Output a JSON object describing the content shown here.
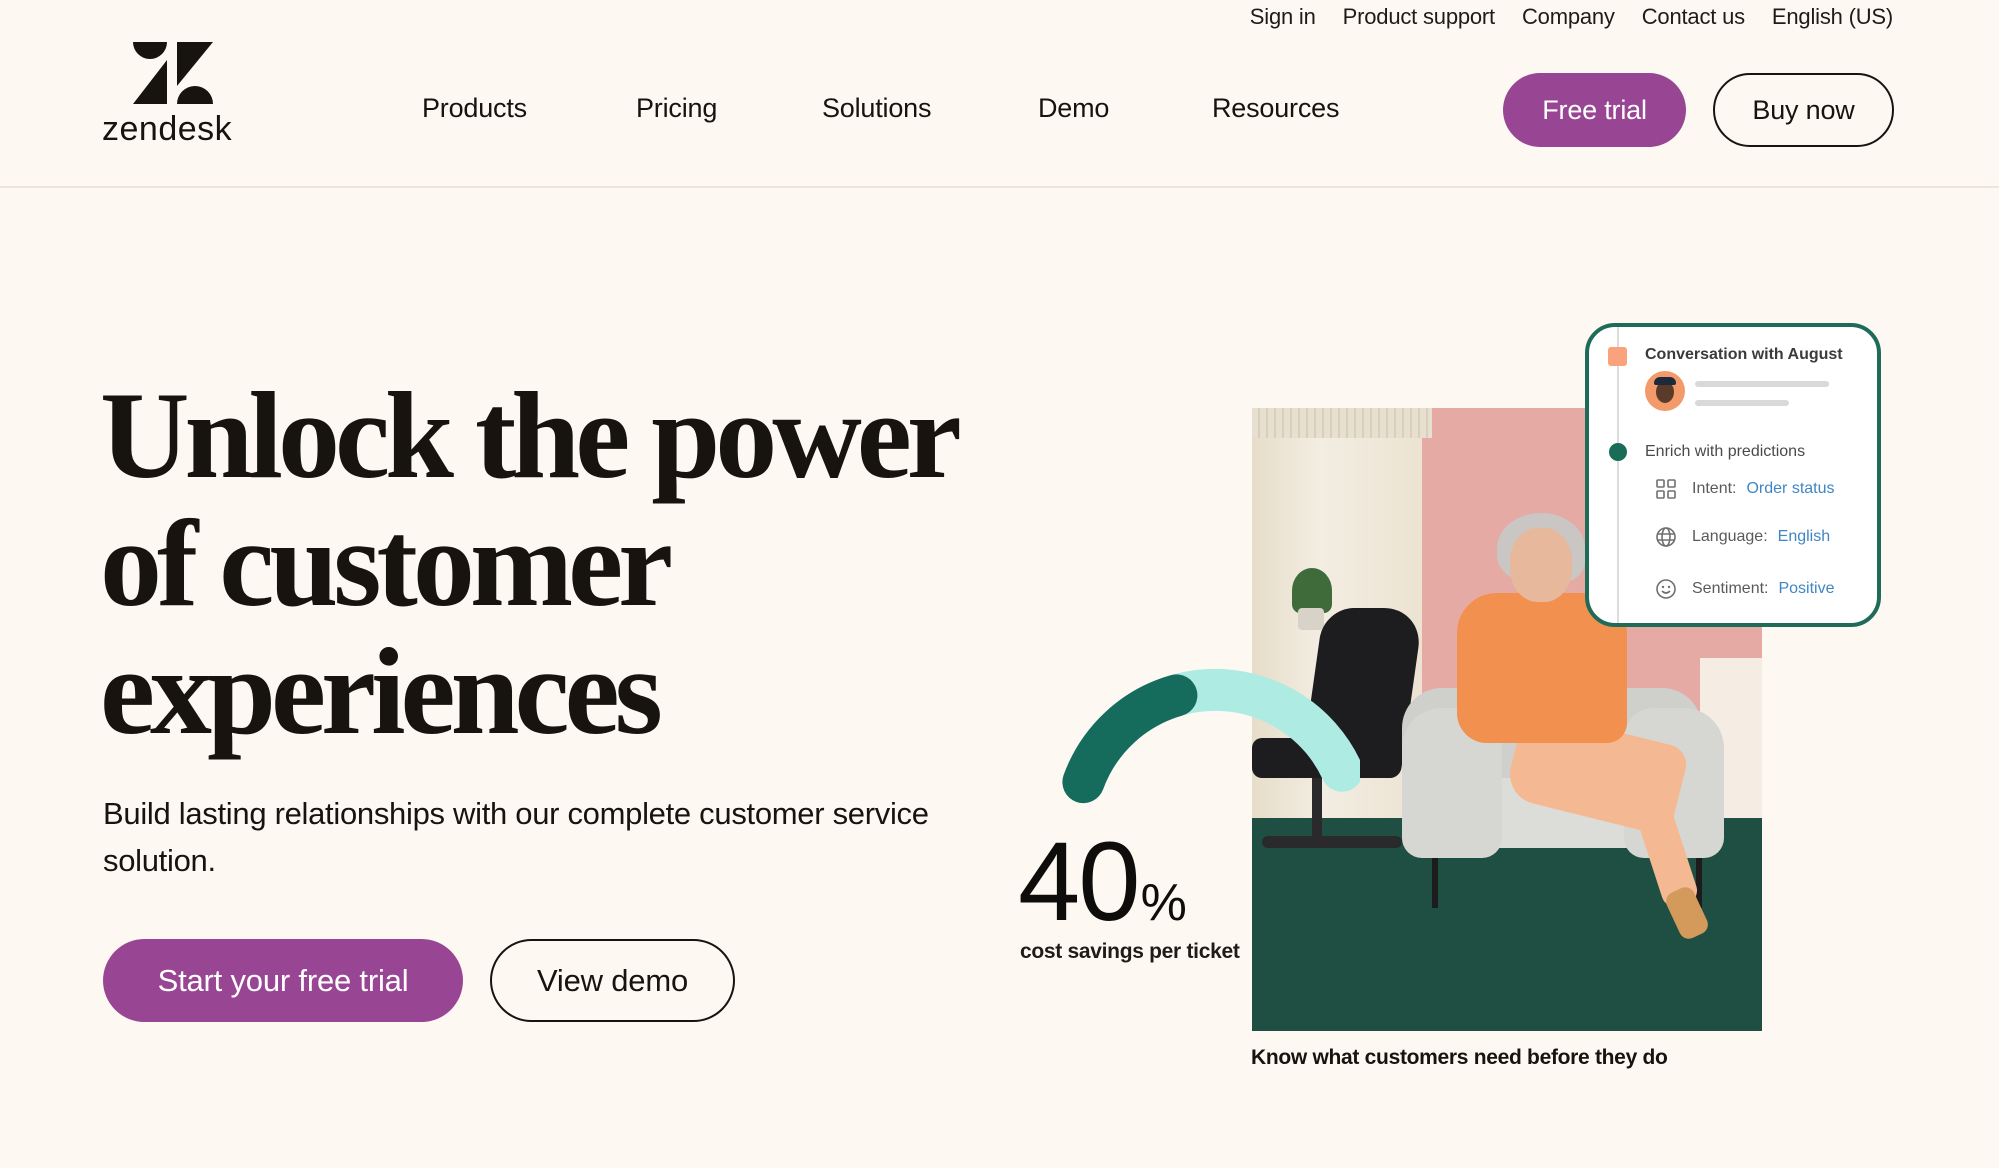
{
  "brand": {
    "name": "zendesk",
    "accent": "#984693",
    "dark_green": "#1b6b59",
    "mint": "#aeebe3"
  },
  "utility_nav": [
    "Sign in",
    "Product support",
    "Company",
    "Contact us",
    "English (US)"
  ],
  "main_nav": [
    "Products",
    "Pricing",
    "Solutions",
    "Demo",
    "Resources"
  ],
  "header_buttons": {
    "free_trial": "Free trial",
    "buy_now": "Buy now"
  },
  "hero": {
    "headline_lines": [
      "Unlock the power",
      "of customer",
      "experiences"
    ],
    "subhead": "Build lasting relationships with our complete customer service solution.",
    "primary_cta": "Start your free trial",
    "secondary_cta": "View demo"
  },
  "stat": {
    "value": "40",
    "unit": "%",
    "label": "cost savings per ticket",
    "gauge_fraction": 0.4
  },
  "photo_caption": "Know what customers need before they do",
  "conversation_card": {
    "title": "Conversation with August",
    "section": "Enrich with predictions",
    "rows": [
      {
        "icon": "grid-icon",
        "label": "Intent:",
        "value": "Order status"
      },
      {
        "icon": "globe-icon",
        "label": "Language:",
        "value": "English"
      },
      {
        "icon": "smiley-icon",
        "label": "Sentiment:",
        "value": "Positive"
      }
    ]
  }
}
